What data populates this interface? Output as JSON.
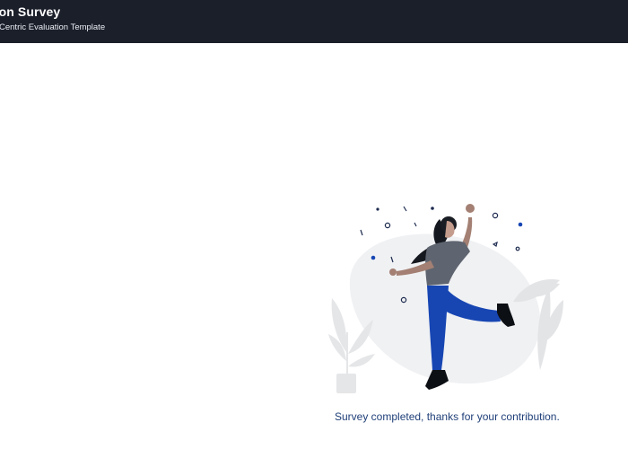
{
  "header": {
    "title": "ction Survey",
    "subtitle": "mer Centric Evaluation Template"
  },
  "main": {
    "completion_message": "Survey completed, thanks for your contribution.",
    "illustration_icon": "celebrating-person-icon"
  },
  "colors": {
    "header_bg": "#1b1f2a",
    "accent_blue": "#1746b3",
    "message_text": "#1f3f78"
  }
}
